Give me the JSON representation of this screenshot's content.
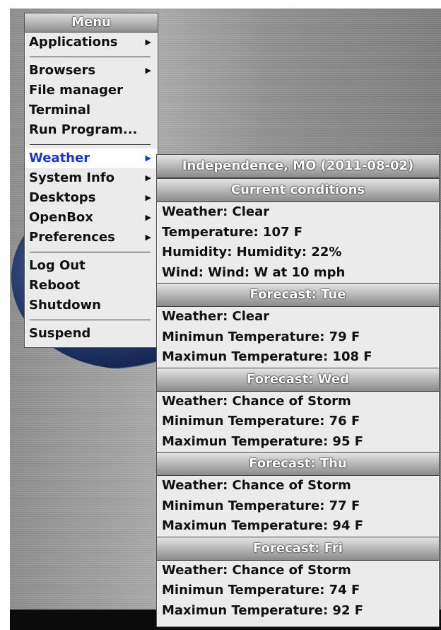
{
  "main_menu": {
    "title": "Menu",
    "groups": [
      [
        {
          "label": "Applications",
          "submenu": true
        }
      ],
      [
        {
          "label": "Browsers",
          "submenu": true
        },
        {
          "label": "File manager",
          "submenu": false
        },
        {
          "label": "Terminal",
          "submenu": false
        },
        {
          "label": "Run Program...",
          "submenu": false
        }
      ],
      [
        {
          "label": "Weather",
          "submenu": true,
          "active": true
        },
        {
          "label": "System Info",
          "submenu": true
        },
        {
          "label": "Desktops",
          "submenu": true
        },
        {
          "label": "OpenBox",
          "submenu": true
        },
        {
          "label": "Preferences",
          "submenu": true
        }
      ],
      [
        {
          "label": "Log Out",
          "submenu": false
        },
        {
          "label": "Reboot",
          "submenu": false
        },
        {
          "label": "Shutdown",
          "submenu": false
        }
      ],
      [
        {
          "label": "Suspend",
          "submenu": false
        }
      ]
    ]
  },
  "weather_menu": {
    "location": "Independence, MO (2011-08-02)",
    "current": {
      "title": "Current conditions",
      "weather": "Weather: Clear",
      "temperature": "Temperature: 107 F",
      "humidity": "Humidity: Humidity: 22%",
      "wind": "Wind: Wind: W at 10 mph"
    },
    "forecasts": [
      {
        "title": "Forecast: Tue",
        "weather": "Weather: Clear",
        "min": "Minimun Temperature: 79 F",
        "max": "Maximun Temperature: 108 F"
      },
      {
        "title": "Forecast: Wed",
        "weather": "Weather: Chance of Storm",
        "min": "Minimun Temperature: 76 F",
        "max": "Maximun Temperature: 95 F"
      },
      {
        "title": "Forecast: Thu",
        "weather": "Weather: Chance of Storm",
        "min": "Minimun Temperature: 77 F",
        "max": "Maximun Temperature: 94 F"
      },
      {
        "title": "Forecast: Fri",
        "weather": "Weather: Chance of Storm",
        "min": "Minimun Temperature: 74 F",
        "max": "Maximun Temperature: 92 F"
      }
    ]
  },
  "colors": {
    "active_item_text": "#1a35d6",
    "menu_background": "#ebebeb"
  }
}
